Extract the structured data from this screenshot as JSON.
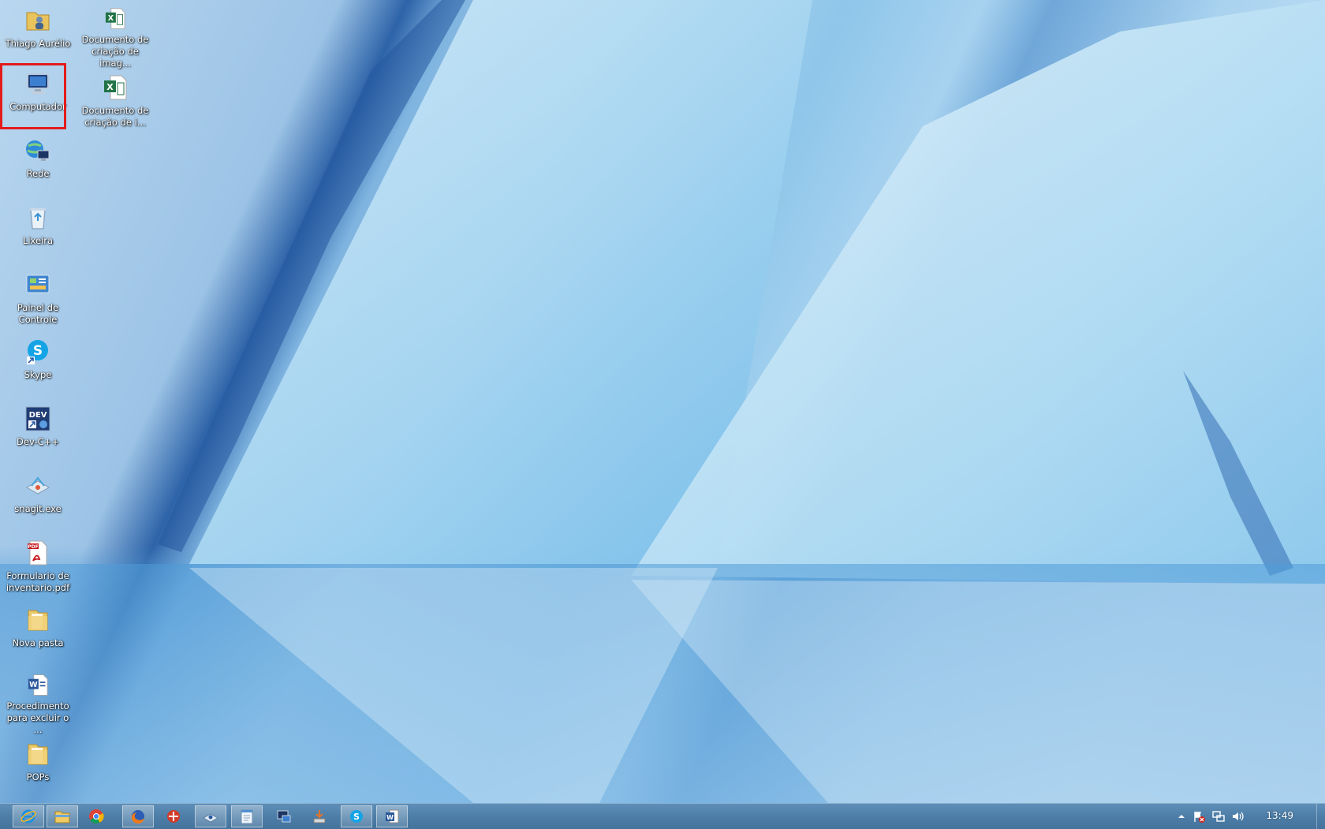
{
  "desktop": {
    "icons": [
      {
        "label": "Thiago Aurélio",
        "icon": "user-folder-icon"
      },
      {
        "label": "Computador",
        "icon": "computer-icon",
        "selected": true
      },
      {
        "label": "Rede",
        "icon": "network-icon"
      },
      {
        "label": "Lixeira",
        "icon": "recycle-bin-icon"
      },
      {
        "label": "Painel de\nControle",
        "icon": "control-panel-icon"
      },
      {
        "label": "Skype",
        "icon": "skype-icon"
      },
      {
        "label": "Dev-C++",
        "icon": "devcpp-icon"
      },
      {
        "label": "snagit.exe",
        "icon": "snagit-icon"
      },
      {
        "label": "Formulario de\ninventario.pdf",
        "icon": "pdf-icon"
      },
      {
        "label": "Nova pasta",
        "icon": "folder-icon"
      },
      {
        "label": "Procedimento\npara excluir o ...",
        "icon": "word-icon"
      },
      {
        "label": "POPs",
        "icon": "folder-icon"
      },
      {
        "label": "Documento de\ncriação de imag...",
        "icon": "excel-icon"
      },
      {
        "label": "Documento de\ncriação de i...",
        "icon": "excel-icon"
      }
    ]
  },
  "taskbar": {
    "apps": [
      {
        "icon": "internet-explorer-icon",
        "active": true
      },
      {
        "icon": "file-explorer-icon",
        "active": true
      },
      {
        "icon": "chrome-icon",
        "active": false
      },
      {
        "icon": "firefox-icon",
        "active": true
      },
      {
        "icon": "app-icon",
        "active": false
      },
      {
        "icon": "snagit-taskbar-icon",
        "active": true
      },
      {
        "icon": "notepad-icon",
        "active": true
      },
      {
        "icon": "network-monitor-icon",
        "active": false
      },
      {
        "icon": "installer-icon",
        "active": false
      },
      {
        "icon": "skype-taskbar-icon",
        "active": true
      },
      {
        "icon": "word-taskbar-icon",
        "active": true
      }
    ],
    "tray": {
      "icons": [
        "show-hidden-icons-icon",
        "action-center-flag-icon",
        "network-tray-icon",
        "volume-icon"
      ],
      "clock": "13:49"
    }
  },
  "colors": {
    "taskbar": "#4d7ea8",
    "selection_highlight": "#e31b1b"
  }
}
